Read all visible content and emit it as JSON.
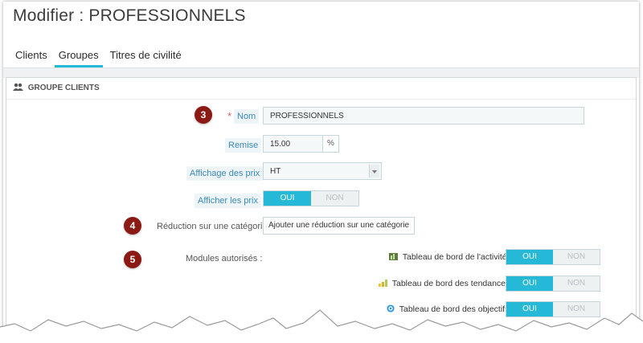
{
  "page": {
    "title": "Modifier : PROFESSIONNELS"
  },
  "tabs": [
    {
      "label": "Clients",
      "active": false
    },
    {
      "label": "Groupes",
      "active": true
    },
    {
      "label": "Titres de civilité",
      "active": false
    }
  ],
  "panel": {
    "heading": "GROUPE CLIENTS",
    "heading_icon": "users-icon"
  },
  "form": {
    "nom": {
      "label": "Nom",
      "required_mark": "*",
      "value": "PROFESSIONNELS",
      "badge": "3"
    },
    "remise": {
      "label": "Remise",
      "value": "15.00",
      "suffix": "%"
    },
    "affichage": {
      "label": "Affichage des prix",
      "value": "HT"
    },
    "afficher": {
      "label": "Afficher les prix",
      "on": "OUI",
      "off": "NON",
      "selected": "OUI"
    },
    "reduction": {
      "label": "Réduction sur une catégorie",
      "button": "Ajouter une réduction sur une catégorie",
      "badge": "4"
    },
    "modules": {
      "label": "Modules autorisés :",
      "badge": "5",
      "items": [
        {
          "label": "Tableau de bord de l'activité",
          "icon": "dashboard-activity-icon",
          "on": "OUI",
          "off": "NON",
          "selected": "OUI"
        },
        {
          "label": "Tableau de bord des tendances",
          "icon": "dashboard-trends-icon",
          "on": "OUI",
          "off": "NON",
          "selected": "OUI"
        },
        {
          "label": "Tableau de bord des objectifs",
          "icon": "dashboard-goals-icon",
          "on": "OUI",
          "off": "NON",
          "selected": "OUI"
        }
      ]
    }
  },
  "colors": {
    "accent": "#25b9d7",
    "badge": "#8b1a14",
    "label": "#3b8ab8"
  }
}
